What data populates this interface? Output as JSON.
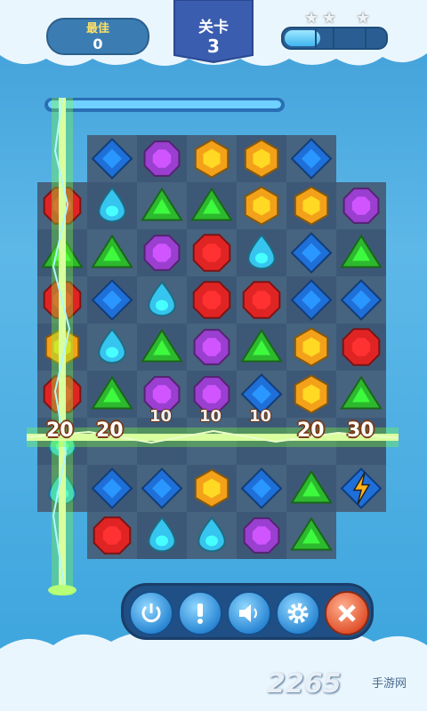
{
  "hud": {
    "best_label": "最佳",
    "best_value": "0",
    "level_label": "关卡",
    "level_value": "3",
    "progress_fraction": 0.36
  },
  "board": {
    "rows": [
      [
        "",
        "blue",
        "purple",
        "orange",
        "orange",
        "blue",
        ""
      ],
      [
        "red",
        "cyan",
        "green",
        "green",
        "orange",
        "orange",
        "purple"
      ],
      [
        "green",
        "green",
        "purple",
        "red",
        "cyan",
        "blue",
        "green"
      ],
      [
        "red",
        "blue",
        "cyan",
        "red",
        "red",
        "blue",
        "blue"
      ],
      [
        "orange",
        "cyan",
        "green",
        "purple",
        "green",
        "orange",
        "red"
      ],
      [
        "red",
        "green",
        "purple",
        "purple",
        "blue",
        "orange",
        "green"
      ],
      [
        "cyan",
        "",
        "",
        "",
        "",
        "",
        ""
      ],
      [
        "cyan",
        "blue",
        "blue",
        "orange",
        "blue",
        "green",
        "lightning"
      ],
      [
        "",
        "red",
        "cyan",
        "cyan",
        "purple",
        "green",
        ""
      ]
    ],
    "score_popups": [
      "20",
      "20",
      "10",
      "10",
      "10",
      "20",
      "30"
    ]
  },
  "controls": {
    "icons": [
      "power-icon",
      "info-icon",
      "sound-icon",
      "settings-icon",
      "close-icon"
    ]
  },
  "watermark": {
    "text": "2265",
    "suffix": "手游网"
  },
  "colors": {
    "blue": "#1f6fd8",
    "purple": "#9a3fd0",
    "orange": "#f4a11a",
    "red": "#e02424",
    "cyan": "#35c5ee",
    "green": "#2db92e"
  }
}
